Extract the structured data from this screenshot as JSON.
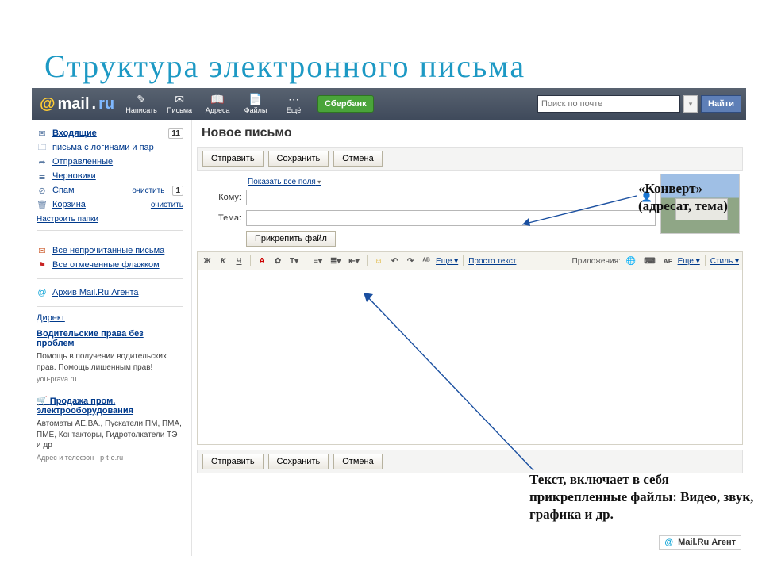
{
  "slide": {
    "title": "Структура электронного письма"
  },
  "logo": {
    "at": "@",
    "mail": "mail",
    "dot": ".",
    "ru": "ru"
  },
  "toolbar": {
    "items": [
      {
        "icon": "✎",
        "label": "Написать"
      },
      {
        "icon": "✉",
        "label": "Письма"
      },
      {
        "icon": "📖",
        "label": "Адреса"
      },
      {
        "icon": "📄",
        "label": "Файлы"
      },
      {
        "icon": "⋯",
        "label": "Ещё"
      }
    ],
    "promo": "Сбербанк"
  },
  "search": {
    "placeholder": "Поиск по почте",
    "button": "Найти"
  },
  "sidebar": {
    "folders": [
      {
        "icon": "✉",
        "label": "Входящие",
        "bold": true,
        "count": "11"
      },
      {
        "icon": "🗀",
        "label": "письма с логинами и пар"
      },
      {
        "icon": "➦",
        "label": "Отправленные"
      },
      {
        "icon": "≣",
        "label": "Черновики"
      },
      {
        "icon": "⊘",
        "label": "Спам",
        "action": "очистить",
        "count": "1"
      },
      {
        "icon": "🗑",
        "label": "Корзина",
        "action": "очистить"
      }
    ],
    "manage": "Настроить папки",
    "filters": [
      {
        "icon": "✉",
        "label": "Все непрочитанные письма"
      },
      {
        "icon": "⚑",
        "label": "Все отмеченные флажком"
      }
    ],
    "archive": "Архив Mail.Ru Агента",
    "direct": "Директ",
    "ads": [
      {
        "title": "Водительские права без проблем",
        "desc": "Помощь в получении водительских прав. Помощь лишенным прав!",
        "url": "you-prava.ru"
      },
      {
        "title": "Продажа пром. электрооборудования",
        "desc": "Автоматы АЕ,ВА., Пускатели ПМ, ПМА, ПМЕ, Контакторы, Гидротолкатели ТЭ и др",
        "url": "Адрес и телефон · p-t-e.ru"
      }
    ]
  },
  "compose": {
    "heading": "Новое письмо",
    "send": "Отправить",
    "save": "Сохранить",
    "cancel": "Отмена",
    "show_all": "Показать все поля",
    "to_label": "Кому:",
    "subj_label": "Тема:",
    "attach": "Прикрепить файл"
  },
  "editor_toolbar": {
    "bold": "Ж",
    "italic": "К",
    "underline": "Ч",
    "more": "Еще",
    "plain": "Просто текст",
    "apps": "Приложения:",
    "style": "Стиль"
  },
  "annotations": {
    "envelope": "«Конверт» (адресат, тема)",
    "body": "Текст, включает в себя прикрепленные файлы: Видео, звук, графика и др."
  },
  "agent": "Mail.Ru Агент"
}
